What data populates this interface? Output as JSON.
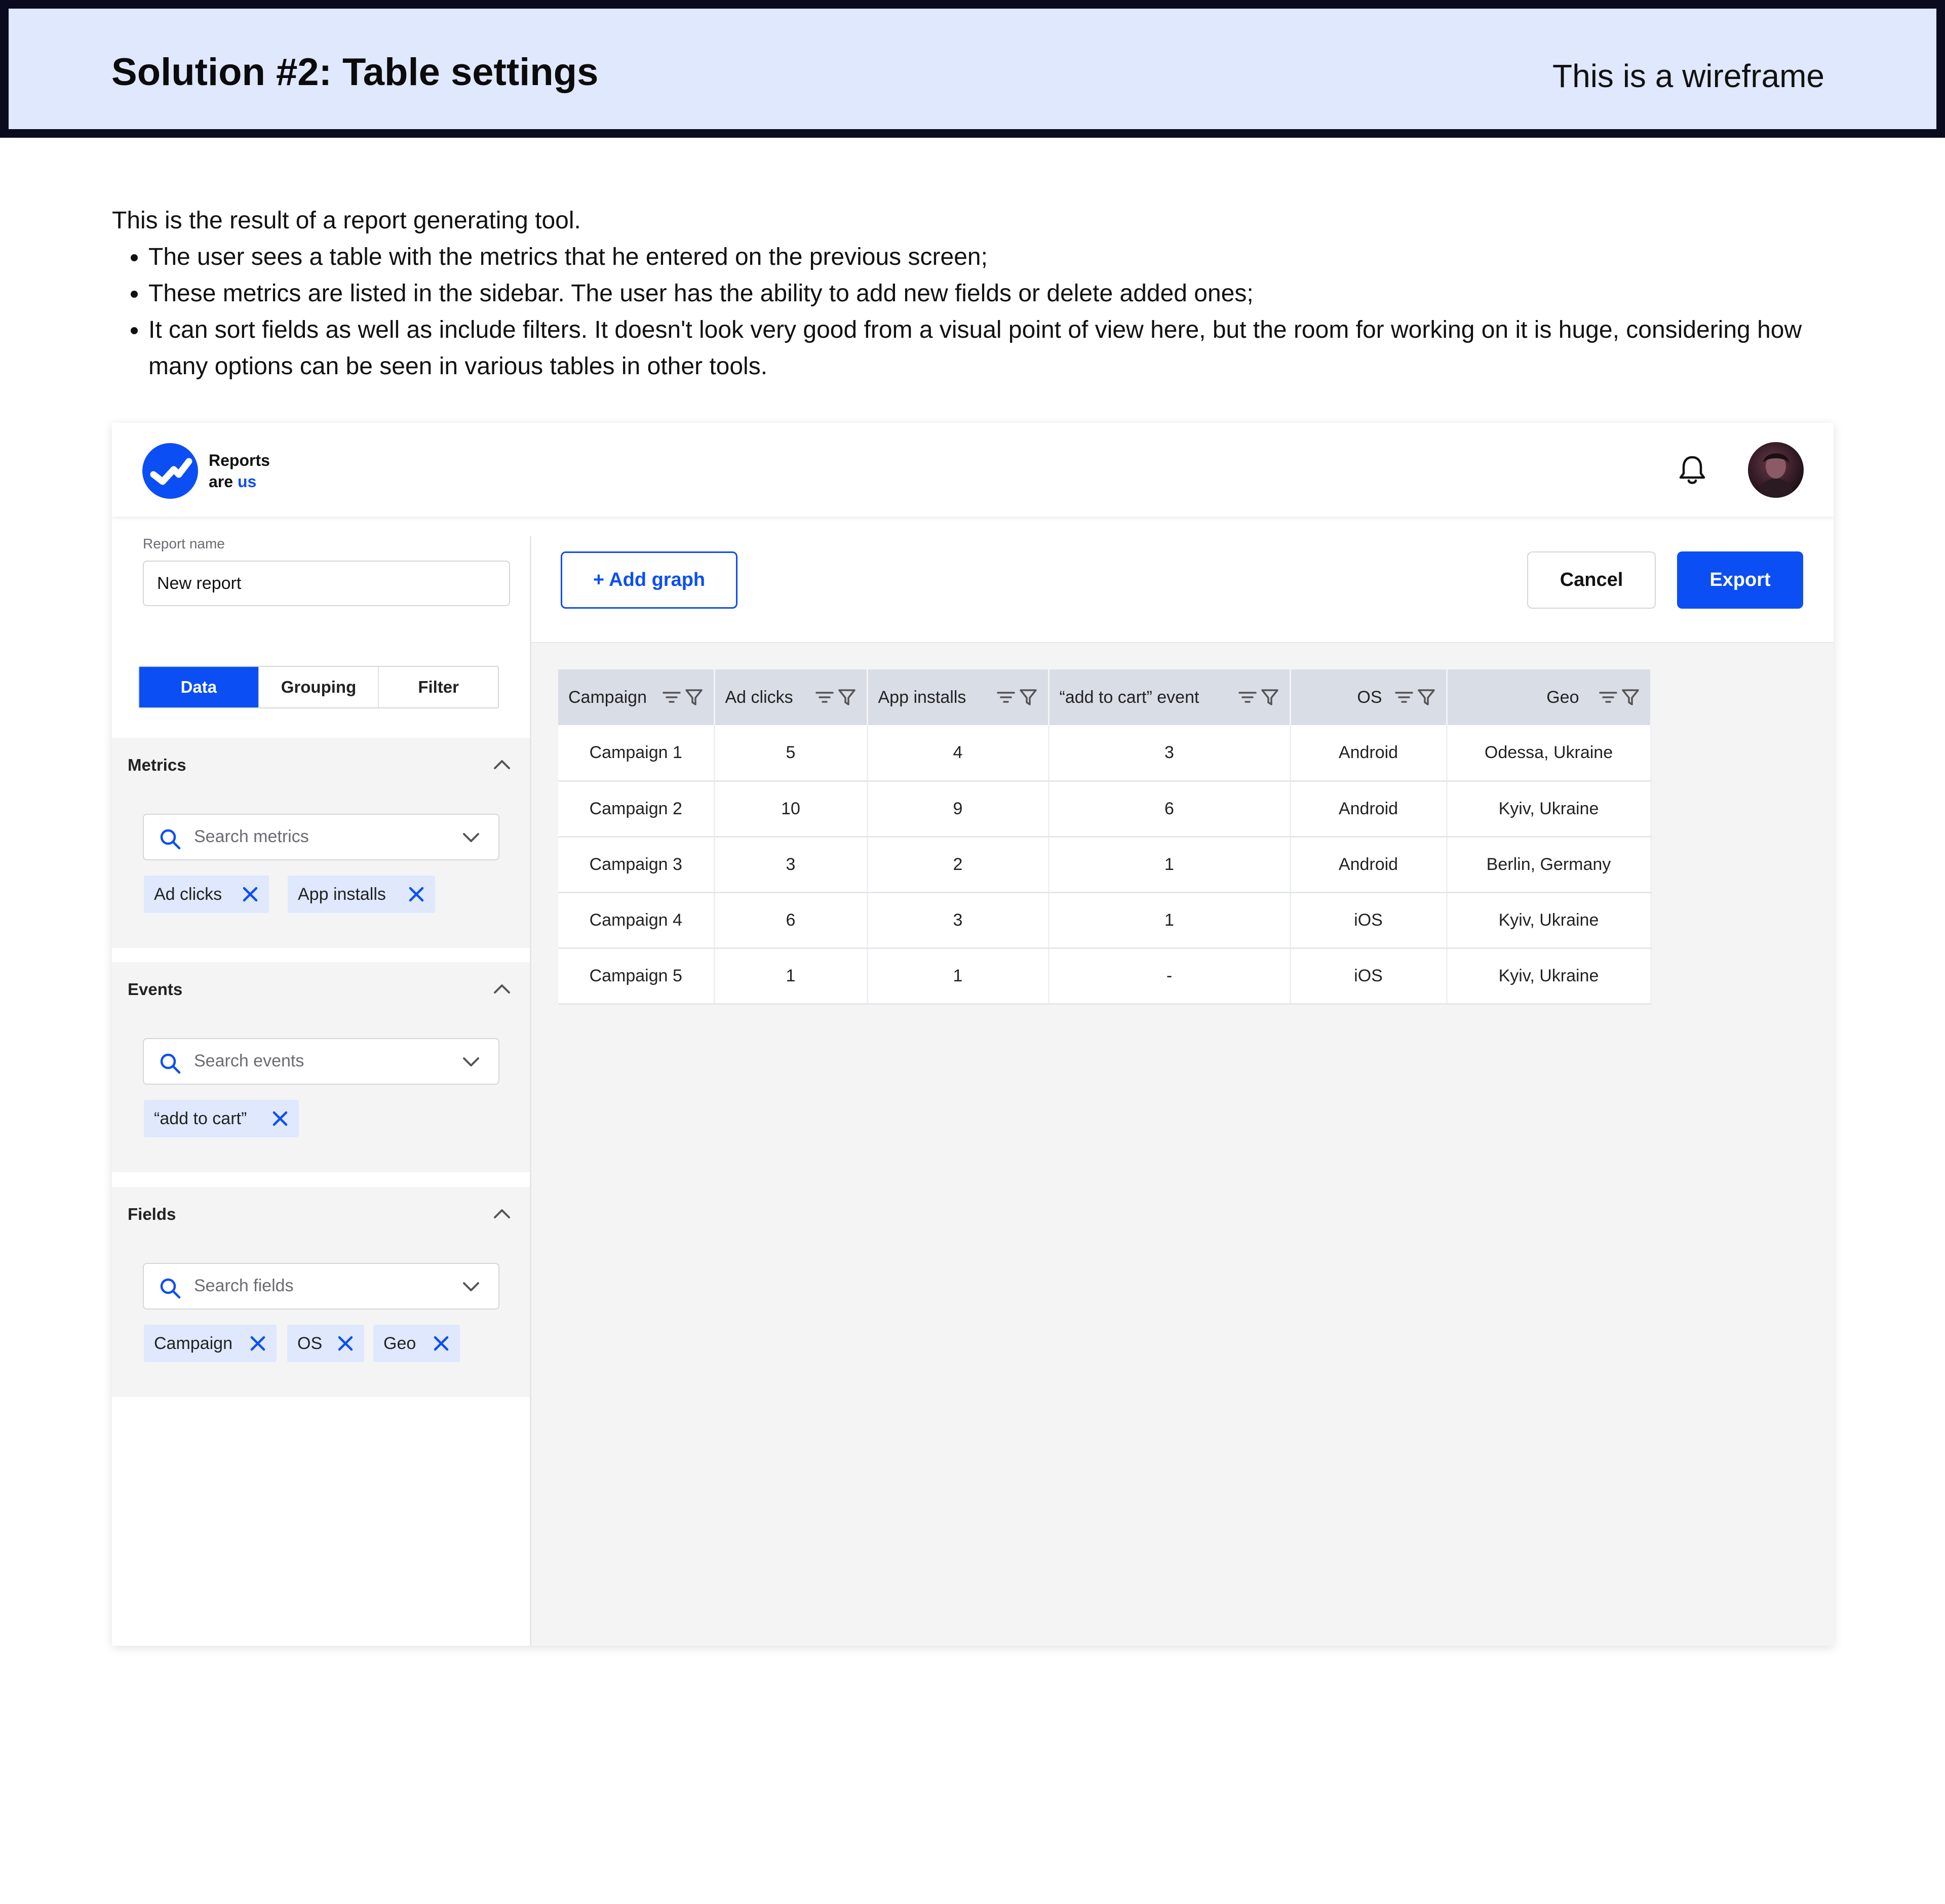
{
  "page": {
    "title": "Solution #2: Table settings",
    "wireframe_note": "This is a wireframe",
    "intro": "This is the result of a report generating tool.",
    "bullets": [
      "The user sees a table with the metrics that he entered on the previous screen;",
      "These metrics are listed in the sidebar. The user has the ability to add new fields or delete added ones;",
      "It can sort fields as well as include filters. It doesn't look very good from a visual point of view here, but the room for working on it is huge, considering how many options can be seen in various tables in other tools."
    ]
  },
  "app": {
    "brand": {
      "line1": "Reports",
      "line2_prefix": "are ",
      "line2_accent": "us"
    },
    "icons": {
      "logo": "check-logo-icon",
      "bell": "bell-icon",
      "avatar": "user-avatar"
    },
    "colors": {
      "accent": "#0b4ef4",
      "chip_bg": "#dfe8fd",
      "header_bg": "#dfe8fd",
      "table_header_bg": "#d9dde6"
    },
    "report_name": {
      "label": "Report name",
      "value": "New report"
    },
    "toolbar": {
      "add_graph": "+ Add graph",
      "cancel": "Cancel",
      "export": "Export"
    },
    "tabs": [
      "Data",
      "Grouping",
      "Filter"
    ],
    "active_tab": "Data",
    "sections": {
      "metrics": {
        "title": "Metrics",
        "placeholder": "Search metrics",
        "chips": [
          "Ad clicks",
          "App installs"
        ]
      },
      "events": {
        "title": "Events",
        "placeholder": "Search events",
        "chips": [
          "“add to cart”"
        ]
      },
      "fields": {
        "title": "Fields",
        "placeholder": "Search fields",
        "chips": [
          "Campaign",
          "OS",
          "Geo"
        ]
      }
    },
    "table": {
      "headers": [
        "Campaign",
        "Ad clicks",
        "App installs",
        "“add to cart” event",
        "OS",
        "Geo"
      ],
      "rows": [
        [
          "Campaign 1",
          "5",
          "4",
          "3",
          "Android",
          "Odessa, Ukraine"
        ],
        [
          "Campaign 2",
          "10",
          "9",
          "6",
          "Android",
          "Kyiv, Ukraine"
        ],
        [
          "Campaign 3",
          "3",
          "2",
          "1",
          "Android",
          "Berlin, Germany"
        ],
        [
          "Campaign 4",
          "6",
          "3",
          "1",
          "iOS",
          "Kyiv, Ukraine"
        ],
        [
          "Campaign 5",
          "1",
          "1",
          "-",
          "iOS",
          "Kyiv, Ukraine"
        ]
      ]
    }
  }
}
